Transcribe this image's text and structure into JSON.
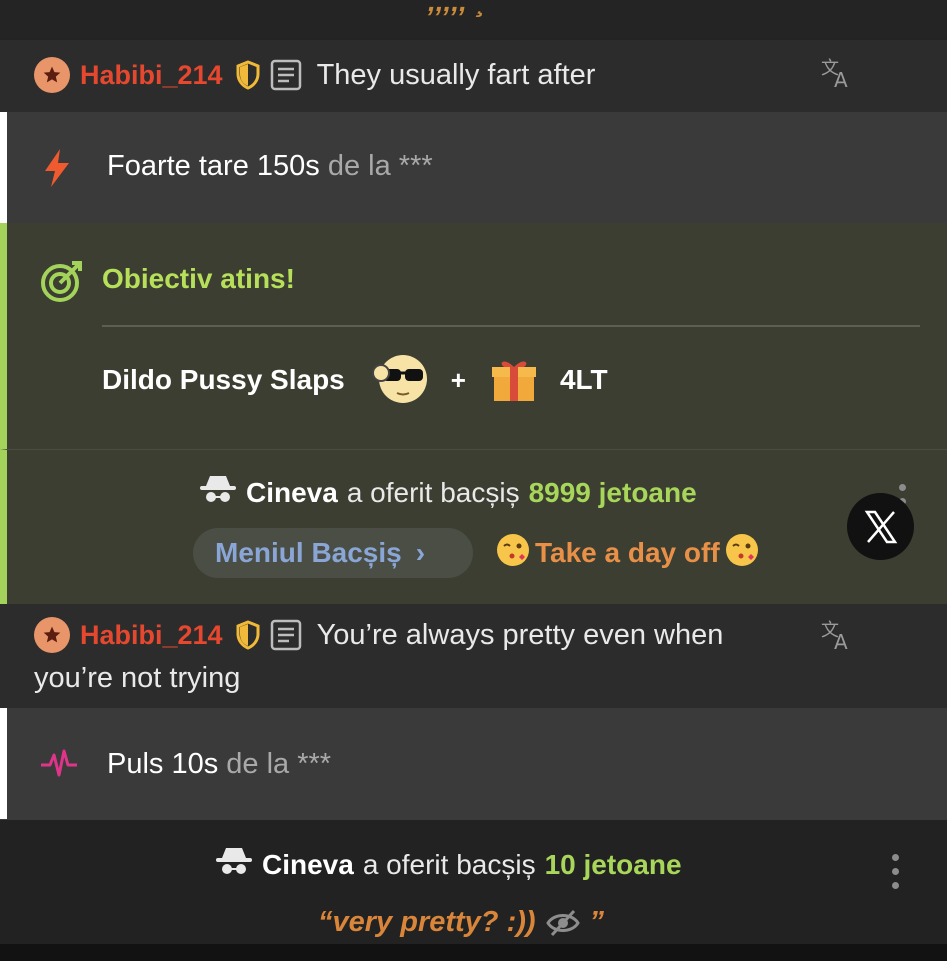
{
  "top": {
    "partial_text": ",,,,,  ¸"
  },
  "messages": [
    {
      "username": "Habibi_214",
      "text": "They usually fart after",
      "continuation": ""
    },
    {
      "username": "Habibi_214",
      "text": "You’re always pretty even when",
      "continuation": "you’re not trying"
    }
  ],
  "notifications": [
    {
      "icon": "lightning-icon",
      "main": "Foarte tare 150s",
      "muted": "de la ***"
    },
    {
      "icon": "pulse-icon",
      "main": "Puls 10s",
      "muted": "de la ***"
    }
  ],
  "goal": {
    "title": "Obiectiv atins!",
    "name": "Dildo Pussy Slaps",
    "plus": "+",
    "amount": "4LT"
  },
  "tip1": {
    "who": "Cineva",
    "verb": "a oferit bacșiș",
    "amount": "8999 jetoane",
    "menu_label": "Meniul Bacșiș",
    "menu_chevron": "›",
    "item": "Take a day off"
  },
  "tip2": {
    "who": "Cineva",
    "verb": "a oferit bacșiș",
    "amount": "10 jetoane",
    "quote_open": "“very pretty? :))",
    "quote_close": "”"
  },
  "colors": {
    "username": "#e5482e",
    "goal_accent": "#a3d35a",
    "tip_amount": "#a8d65a",
    "menu_link": "#8aa6d6",
    "tip_item": "#e99048"
  }
}
